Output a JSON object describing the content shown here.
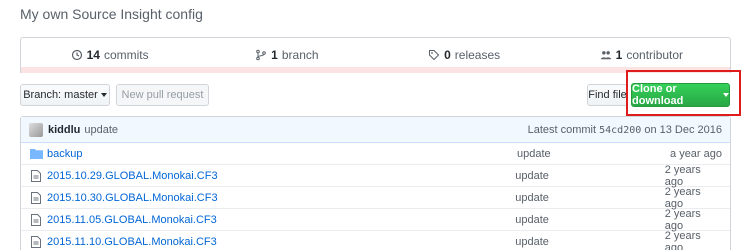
{
  "repo": {
    "description": "My own Source Insight config"
  },
  "summary": {
    "commits_count": "14",
    "commits_label": "commits",
    "branch_count": "1",
    "branch_label": "branch",
    "releases_count": "0",
    "releases_label": "releases",
    "contributors_count": "1",
    "contributors_label": "contributor"
  },
  "toolbar": {
    "branch_label": "Branch: master",
    "new_pr_label": "New pull request",
    "find_file_label": "Find file",
    "clone_label": "Clone or download"
  },
  "latest_commit": {
    "author": "kiddlu",
    "message": "update",
    "prefix": "Latest commit",
    "sha": "54cd200",
    "date_text": "on 13 Dec 2016"
  },
  "files": [
    {
      "type": "folder",
      "name": "backup",
      "message": "update",
      "age": "a year ago"
    },
    {
      "type": "file",
      "name": "2015.10.29.GLOBAL.Monokai.CF3",
      "message": "update",
      "age": "2 years ago"
    },
    {
      "type": "file",
      "name": "2015.10.30.GLOBAL.Monokai.CF3",
      "message": "update",
      "age": "2 years ago"
    },
    {
      "type": "file",
      "name": "2015.11.05.GLOBAL.Monokai.CF3",
      "message": "update",
      "age": "2 years ago"
    },
    {
      "type": "file",
      "name": "2015.11.10.GLOBAL.Monokai.CF3",
      "message": "update",
      "age": "2 years ago"
    }
  ],
  "colors": {
    "link": "#0366d6",
    "clone_button": "#28a745",
    "highlight_box": "#e01b1b"
  }
}
